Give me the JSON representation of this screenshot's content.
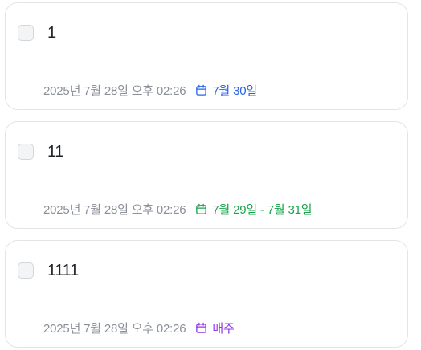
{
  "tasks": [
    {
      "title": "1",
      "checked": false,
      "created": "2025년 7월 28일 오후 02:26",
      "due": {
        "icon": "calendar-icon",
        "text": "7월 30일",
        "color": "#2563eb"
      }
    },
    {
      "title": "11",
      "checked": false,
      "created": "2025년 7월 28일 오후 02:26",
      "due": {
        "icon": "calendar-icon",
        "text": "7월 29일 - 7월 31일",
        "color": "#16a34a"
      }
    },
    {
      "title": "1111",
      "checked": false,
      "created": "2025년 7월 28일 오후 02:26",
      "due": {
        "icon": "calendar-icon",
        "text": "매주",
        "color": "#9333ea"
      }
    }
  ]
}
